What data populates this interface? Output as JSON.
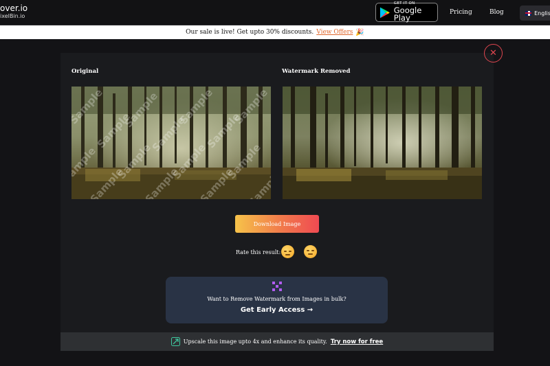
{
  "header": {
    "brand_name": "over.io",
    "brand_sub": "ixelBin.io",
    "play_small": "GET IT ON",
    "play_big": "Google Play",
    "nav": [
      "Pricing",
      "Blog"
    ],
    "language": "English"
  },
  "announcement": {
    "text": "Our sale is live! Get upto 30% discounts.",
    "link": "View Offers",
    "icon": "party-hat-icon"
  },
  "modal": {
    "original_label": "Original",
    "removed_label": "Watermark Removed",
    "watermark_text": "Sample",
    "download_label": "Download Image",
    "rate_label": "Rate this result:",
    "emojis": [
      "sad-face-icon",
      "neutral-face-icon"
    ],
    "bulk_question": "Want to Remove Watermark from Images in bulk?",
    "bulk_cta": "Get Early Access",
    "bulk_cta_arrow": "→",
    "upscale_text": "Upscale this image upto 4x and enhance its quality.",
    "upscale_link": "Try now for free",
    "close_glyph": "✕"
  },
  "colors": {
    "accent_close": "#e0464f",
    "download_gradient": [
      "#f6c34a",
      "#ef4a52"
    ],
    "bulk_bg": "#293345",
    "offer_link": "#e0662a"
  }
}
